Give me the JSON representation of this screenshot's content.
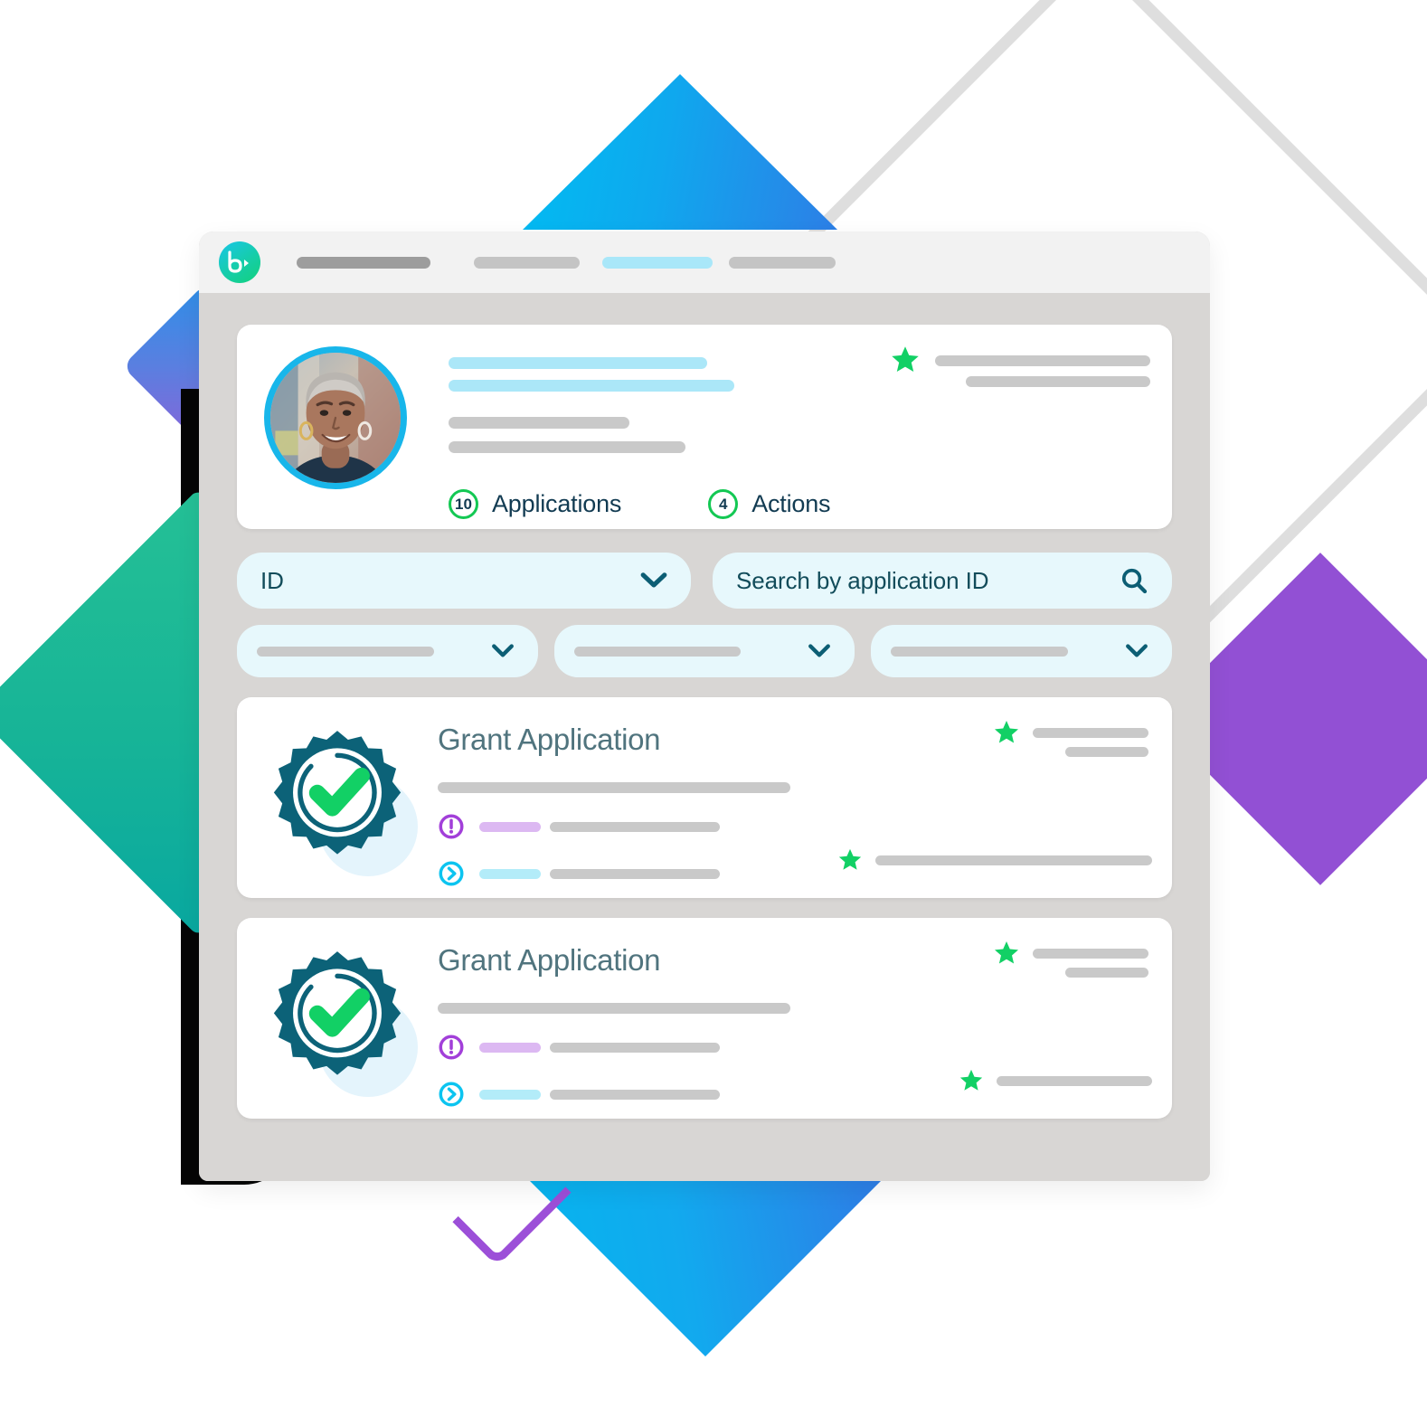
{
  "window": {
    "logo_name": "b-chevron-logo",
    "nav_items": [
      {
        "name": "nav-item-1",
        "state": "inactive"
      },
      {
        "name": "nav-item-2",
        "state": "inactive"
      },
      {
        "name": "nav-item-3",
        "state": "active"
      },
      {
        "name": "nav-item-4",
        "state": "inactive"
      }
    ]
  },
  "profile": {
    "avatar_alt": "user-portrait",
    "stats": [
      {
        "count": "10",
        "label": "Applications"
      },
      {
        "count": "4",
        "label": "Actions"
      }
    ],
    "rating_icon": "star-icon"
  },
  "search": {
    "select_value": "ID",
    "select_icon": "chevron-down-icon",
    "search_placeholder": "Search by application ID",
    "search_icon": "search-icon"
  },
  "filters": [
    {
      "name": "filter-dropdown-1",
      "icon": "chevron-down-icon"
    },
    {
      "name": "filter-dropdown-2",
      "icon": "chevron-down-icon"
    },
    {
      "name": "filter-dropdown-3",
      "icon": "chevron-down-icon"
    }
  ],
  "applications": [
    {
      "title": "Grant Application",
      "seal_icon": "verified-badge-check-icon",
      "alert_icon": "alert-circle-icon",
      "arrow_icon": "arrow-right-circle-icon",
      "star_icon": "star-icon"
    },
    {
      "title": "Grant Application",
      "seal_icon": "verified-badge-check-icon",
      "alert_icon": "alert-circle-icon",
      "arrow_icon": "arrow-right-circle-icon",
      "star_icon": "star-icon"
    }
  ],
  "colors": {
    "accent_cyan": "#18B6EA",
    "accent_green": "#13C853",
    "accent_teal": "#0C6278",
    "accent_purple": "#9C4FD8",
    "field_bg": "#E7F8FC",
    "text_dark": "#123B52",
    "title_gray": "#50747E"
  }
}
